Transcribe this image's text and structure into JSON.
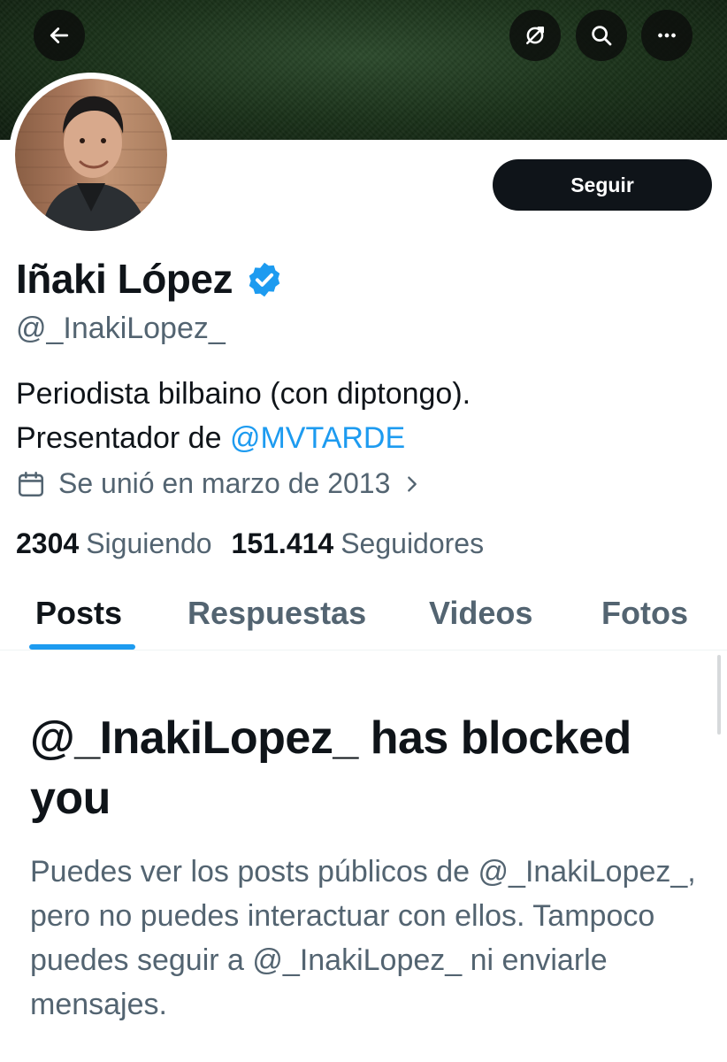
{
  "header": {
    "back_icon": "arrow-left-icon",
    "actions": [
      "no-notifications-icon",
      "search-icon",
      "more-icon"
    ],
    "banner_color": "#1a3019"
  },
  "profile": {
    "name": "Iñaki López",
    "verified": true,
    "handle": "@_InakiLopez_",
    "follow_label": "Seguir",
    "bio_line1": "Periodista bilbaino (con diptongo).",
    "bio_line2_prefix": "Presentador de ",
    "bio_mention": "@MVTARDE",
    "joined": "Se unió en marzo de 2013"
  },
  "stats": {
    "following_count": "2304",
    "following_label": "Siguiendo",
    "followers_count": "151.414",
    "followers_label": "Seguidores"
  },
  "tabs": [
    {
      "label": "Posts",
      "active": true
    },
    {
      "label": "Respuestas",
      "active": false
    },
    {
      "label": "Videos",
      "active": false
    },
    {
      "label": "Fotos",
      "active": false
    }
  ],
  "blocked": {
    "title": "@_InakiLopez_ has blocked you",
    "description": "Puedes ver los posts públicos de @_InakiLopez_, pero no puedes interactuar con ellos. Tampoco puedes seguir a @_InakiLopez_ ni enviarle mensajes."
  },
  "colors": {
    "accent": "#1d9bf0",
    "text": "#0f1419",
    "secondary": "#536471"
  }
}
